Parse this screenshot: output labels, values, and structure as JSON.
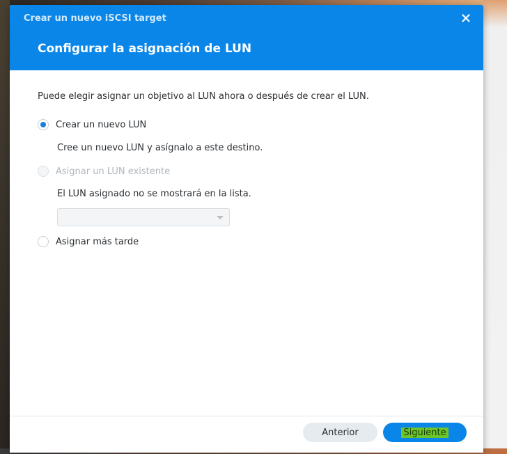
{
  "dialog": {
    "window_title": "Crear un nuevo iSCSI target",
    "step_title": "Configurar la asignación de LUN",
    "close_icon": "close-icon"
  },
  "content": {
    "description": "Puede elegir asignar un objetivo al LUN ahora o después de crear el LUN.",
    "options": [
      {
        "label": "Crear un nuevo LUN",
        "selected": true,
        "enabled": true
      },
      {
        "label": "Asignar un LUN existente",
        "selected": false,
        "enabled": false
      },
      {
        "label": "Asignar más tarde",
        "selected": false,
        "enabled": true
      }
    ],
    "new_lun_help": "Cree un nuevo LUN y asígnalo a este destino.",
    "existing_lun_help": "El LUN asignado no se mostrará en la lista.",
    "existing_lun_select_value": ""
  },
  "footer": {
    "prev_label": "Anterior",
    "next_label": "Siguiente"
  },
  "colors": {
    "header": "#0a86e8",
    "primary_button": "#0a86e8",
    "radio_checked": "#1a7fe0"
  }
}
